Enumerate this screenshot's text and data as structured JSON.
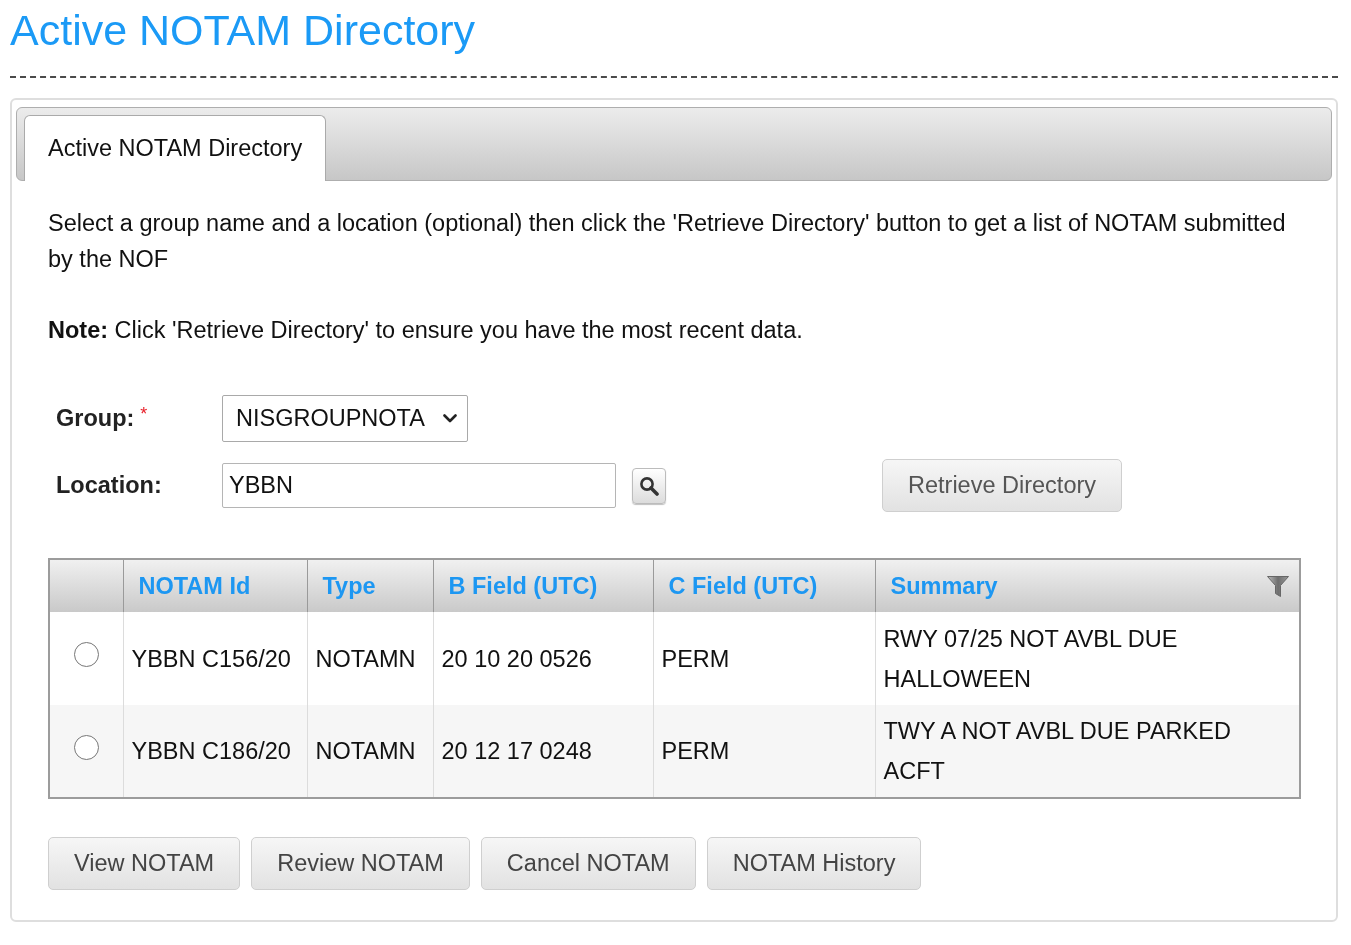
{
  "page_title": "Active NOTAM Directory",
  "tabs": [
    {
      "label": "Active NOTAM Directory",
      "selected": true
    }
  ],
  "description": "Select a group name and a location (optional) then click the 'Retrieve Directory' button to get a list of NOTAM submitted by the NOF",
  "note": "**Note:** Click 'Retrieve Directory' to ensure you have the most recent data.",
  "form": {
    "group": {
      "label": "Group:",
      "required_mark": "*",
      "value": "NISGROUPNOTA"
    },
    "location": {
      "label": "Location:",
      "value": "YBBN"
    },
    "retrieve_button": "Retrieve Directory"
  },
  "table": {
    "columns": [
      "NOTAM Id",
      "Type",
      "B Field (UTC)",
      "C Field (UTC)",
      "Summary"
    ],
    "rows": [
      {
        "selected": false,
        "cells": [
          "YBBN C156/20",
          "NOTAMN",
          "20 10 20 0526",
          "PERM",
          "RWY 07/25 NOT AVBL DUE HALLOWEEN"
        ]
      },
      {
        "selected": false,
        "cells": [
          "YBBN C186/20",
          "NOTAMN",
          "20 12 17 0248",
          "PERM",
          "TWY A NOT AVBL DUE PARKED ACFT"
        ]
      }
    ]
  },
  "buttons": [
    "View NOTAM",
    "Review NOTAM",
    "Cancel NOTAM",
    "NOTAM History"
  ]
}
